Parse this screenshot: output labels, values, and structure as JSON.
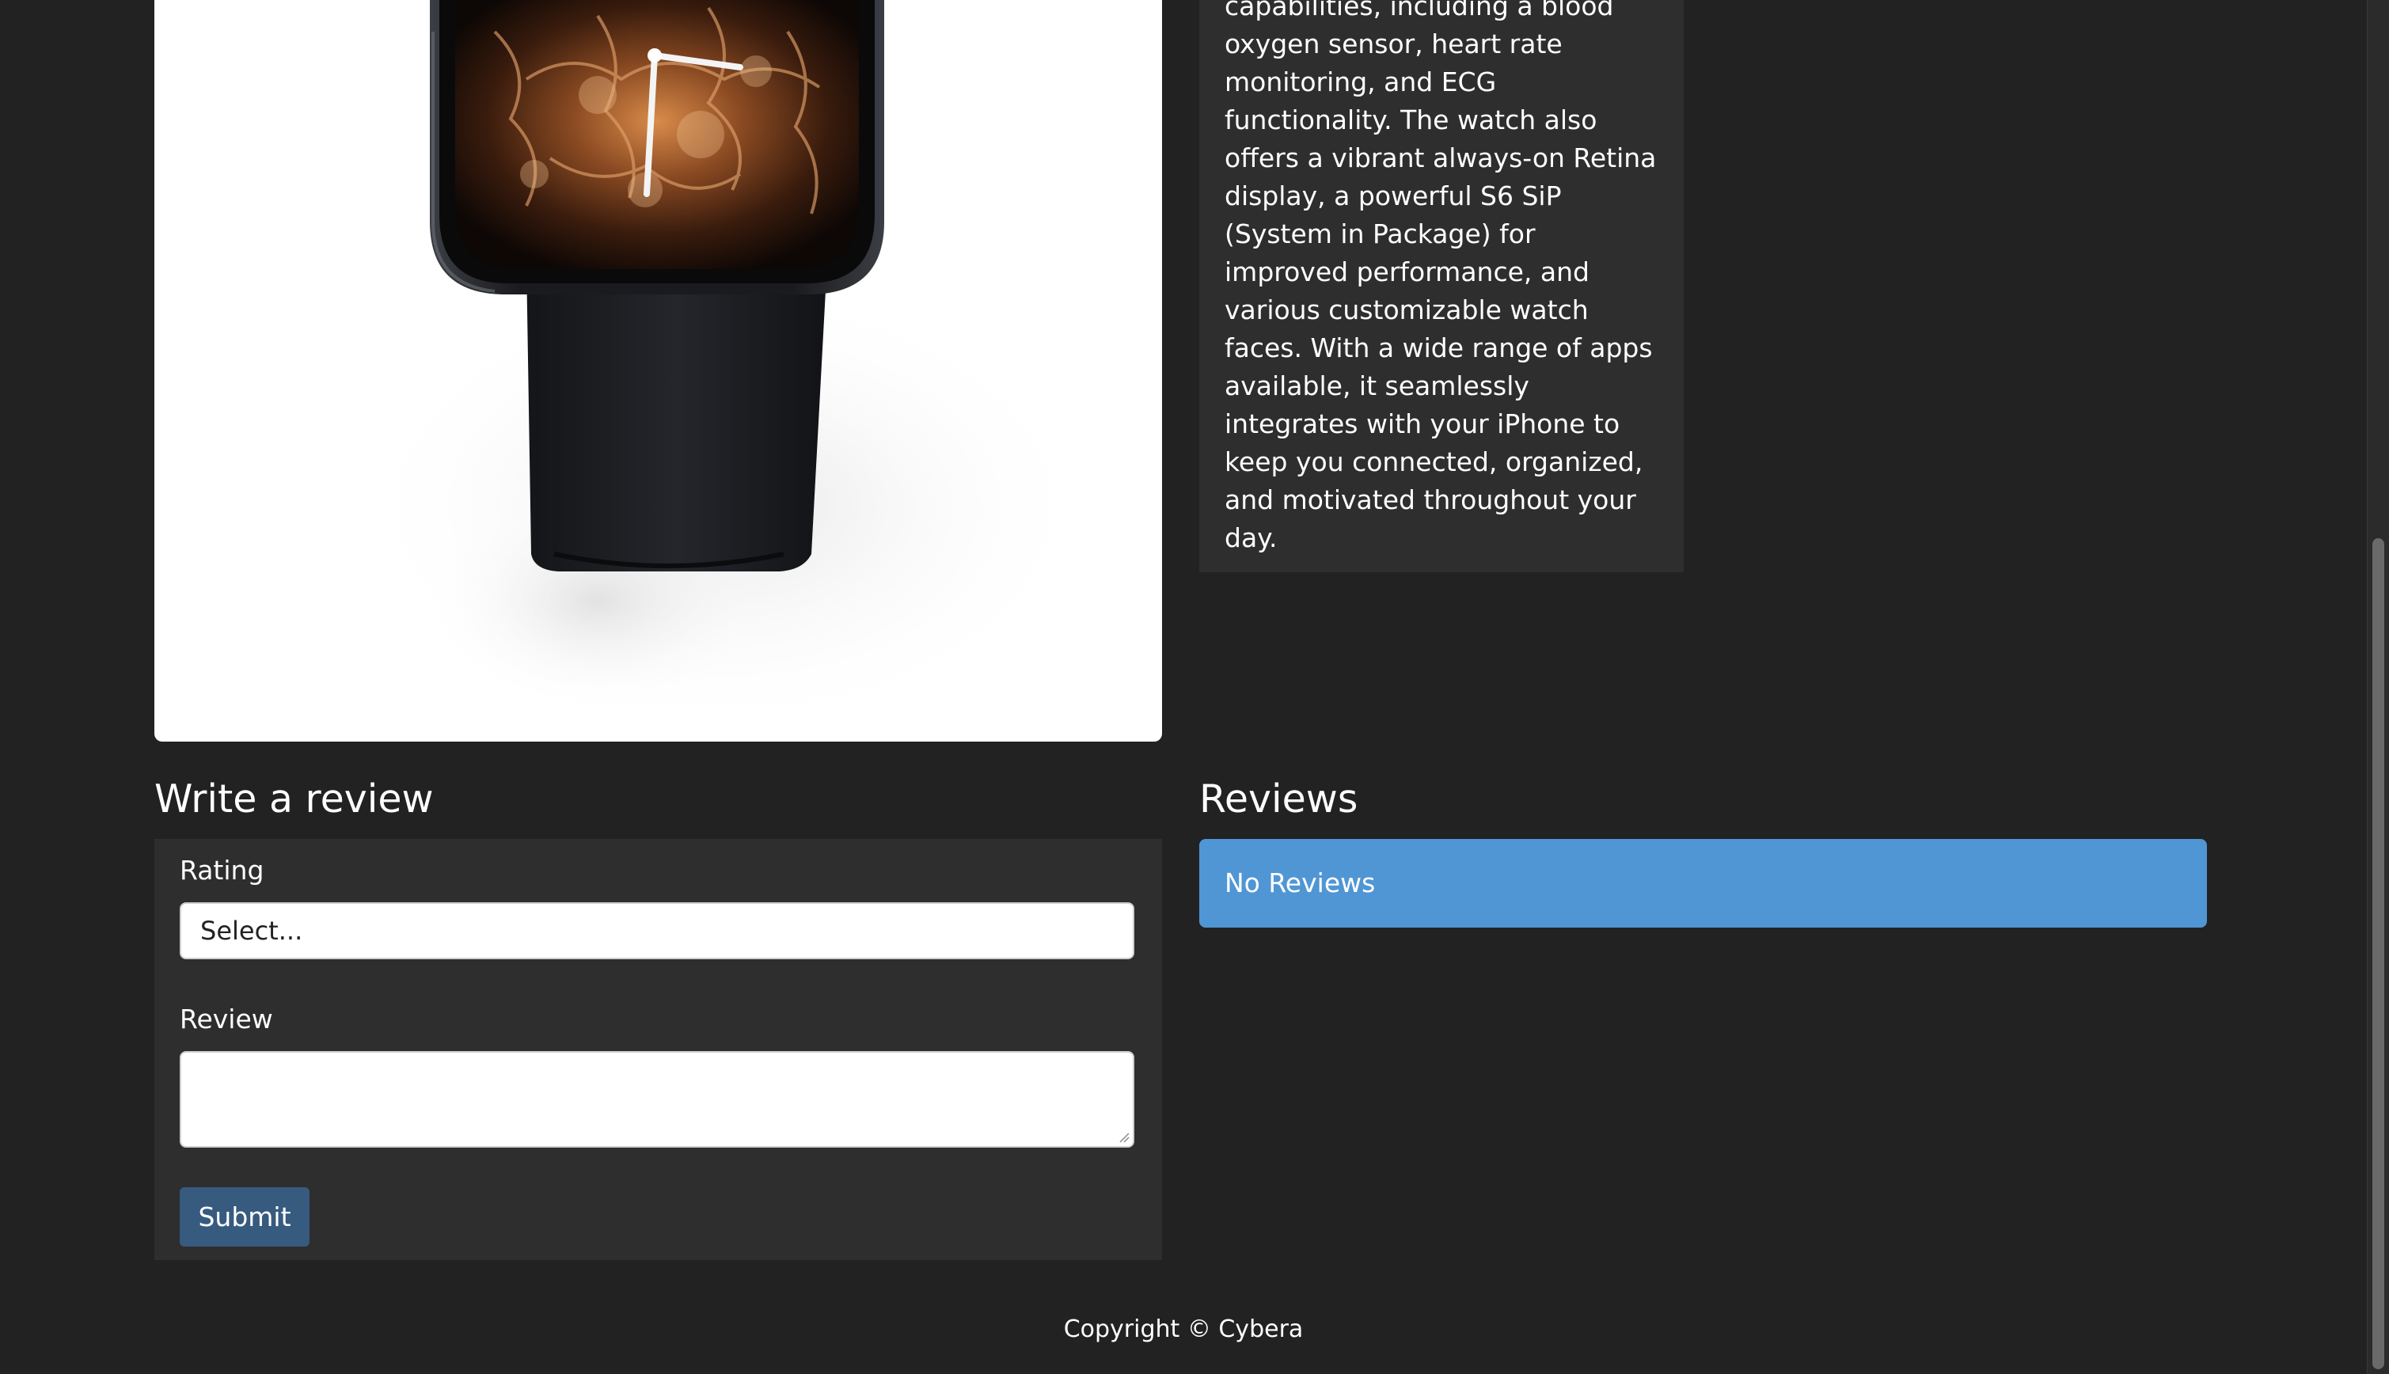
{
  "product": {
    "image_alt": "Smartwatch with black band and flame watch face",
    "description_visible": "of health and fitness tracking capabilities, including a blood oxygen sensor, heart rate monitoring, and ECG functionality. The watch also offers a vibrant always-on Retina display, a powerful S6 SiP (System in Package) for improved performance, and various customizable watch faces. With a wide range of apps available, it seamlessly integrates with your iPhone to keep you connected, organized, and motivated throughout your day."
  },
  "review_form": {
    "title": "Write a review",
    "rating_label": "Rating",
    "rating_selected": "Select...",
    "review_label": "Review",
    "review_value": "",
    "submit_label": "Submit"
  },
  "reviews": {
    "title": "Reviews",
    "empty_message": "No Reviews"
  },
  "footer": {
    "copyright": "Copyright © Cybera"
  },
  "colors": {
    "page_background": "#222222",
    "card_background": "#2e2e2e",
    "submit_button": "#375a7f",
    "info_alert": "#5096d4"
  },
  "icons": {
    "resize_handle": "textarea-resize-icon"
  }
}
